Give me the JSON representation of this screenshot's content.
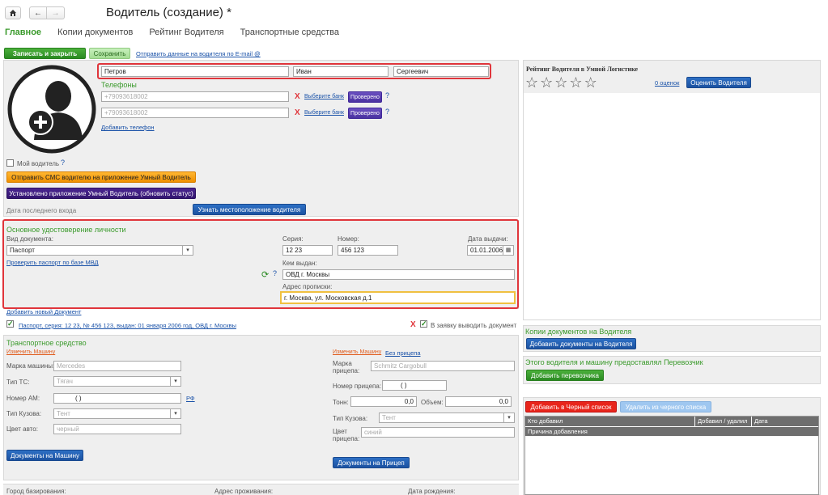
{
  "header": {
    "title": "Водитель (создание) *",
    "home_icon": "home-icon",
    "back_icon": "arrow-left-icon",
    "forward_icon": "arrow-right-icon"
  },
  "tabs": [
    "Главное",
    "Копии документов",
    "Рейтинг Водителя",
    "Транспортные средства"
  ],
  "toolbar": {
    "save_close": "Записать и закрыть",
    "save": "Сохранить",
    "send_email": "Отправить данные на водителя по E-mail @"
  },
  "driver": {
    "last_name": "Петров",
    "first_name": "Иван",
    "middle_name": "Сергеевич"
  },
  "phones": {
    "heading": "Телефоны",
    "items": [
      {
        "value": "+79093618002",
        "bank": "Выберите банк",
        "status": "Проверено"
      },
      {
        "value": "+79093618002",
        "bank": "Выберите банк",
        "status": "Проверено"
      }
    ],
    "add": "Добавить телефон",
    "remove_mark": "X",
    "help": "?"
  },
  "my_driver": {
    "label": "Мой водитель",
    "help": "?"
  },
  "sms_button": "Отправить СМС водителю на приложение Умный Водитель",
  "app_button": "Установлено приложение Умный Водитель (обновить статус)",
  "last_login": "Дата последнего входа",
  "locate_button": "Узнать местоположение водителя",
  "identity": {
    "heading": "Основное удостоверение личности",
    "doc_type_label": "Вид документа:",
    "doc_type": "Паспорт",
    "check_link": "Проверить паспорт по базе МВД",
    "series_label": "Серия:",
    "series": "12 23",
    "number_label": "Номер:",
    "number": "456 123",
    "issue_date_label": "Дата выдачи:",
    "issue_date": "01.01.2006",
    "issued_by_label": "Кем выдан:",
    "issued_by": "ОВД г. Москвы",
    "address_label": "Адрес прописки:",
    "address": "г. Москва, ул. Московская д.1",
    "help": "?"
  },
  "add_doc_link": "Добавить новый Документ",
  "passport_row": {
    "text": "Паспорт, серия: 12 23, № 456 123, выдан: 01 января 2006 год, ОВД г. Москвы",
    "remove_mark": "X",
    "include_label": "В заявку выводить документ"
  },
  "vehicle": {
    "heading": "Транспортное средство",
    "change_car": "Изменить Машину",
    "brand_label": "Марка машины:",
    "brand_ph": "Mercedes",
    "type_label": "Тип ТС:",
    "type_ph": "Тягач",
    "plate_label": "Номер АМ:",
    "plate": "(   )",
    "rf": "РФ",
    "body_label": "Тип Кузова:",
    "body_ph": "Тент",
    "color_label": "Цвет авто:",
    "color_ph": "черный",
    "docs_button": "Документы на Машину"
  },
  "trailer": {
    "change": "Изменить Машину",
    "no_trailer": "Без прицепа",
    "brand_label": "Марка прицепа:",
    "brand_ph": "Schmitz Cargobull",
    "number_label": "Номер прицепа:",
    "number": "(   )",
    "tons_label": "Тонн:",
    "tons": "0,0",
    "volume_label": "Объем:",
    "volume": "0,0",
    "body_label": "Тип Кузова:",
    "body_ph": "Тент",
    "color_label": "Цвет прицепа:",
    "color_ph": "синий",
    "docs_button": "Документы на Прицеп"
  },
  "bottom_labels": [
    "Город базирования:",
    "Адрес проживания:",
    "Дата рождения:"
  ],
  "rating": {
    "heading": "Рейтинг Водителя в Умной Логистике",
    "stars": 5,
    "stars_filled": 0,
    "count_link": "0 оценок",
    "rate_button": "Оценить Водителя"
  },
  "copies": {
    "heading": "Копии документов на Водителя",
    "button": "Добавить документы на Водителя"
  },
  "carrier": {
    "heading": "Этого водителя и машину предоставлял Перевозчик",
    "button": "Добавить перевозчика"
  },
  "blacklist": {
    "add": "Добавить в Черный список",
    "remove": "Удалить из черного списка",
    "columns": [
      "Кто добавил",
      "Добавил / удалил",
      "Дата"
    ],
    "reason": "Причина добавления"
  },
  "colors": {
    "accent_green": "#3a9a2b",
    "highlight_red": "#e0353b",
    "link_blue": "#1a52a8"
  }
}
